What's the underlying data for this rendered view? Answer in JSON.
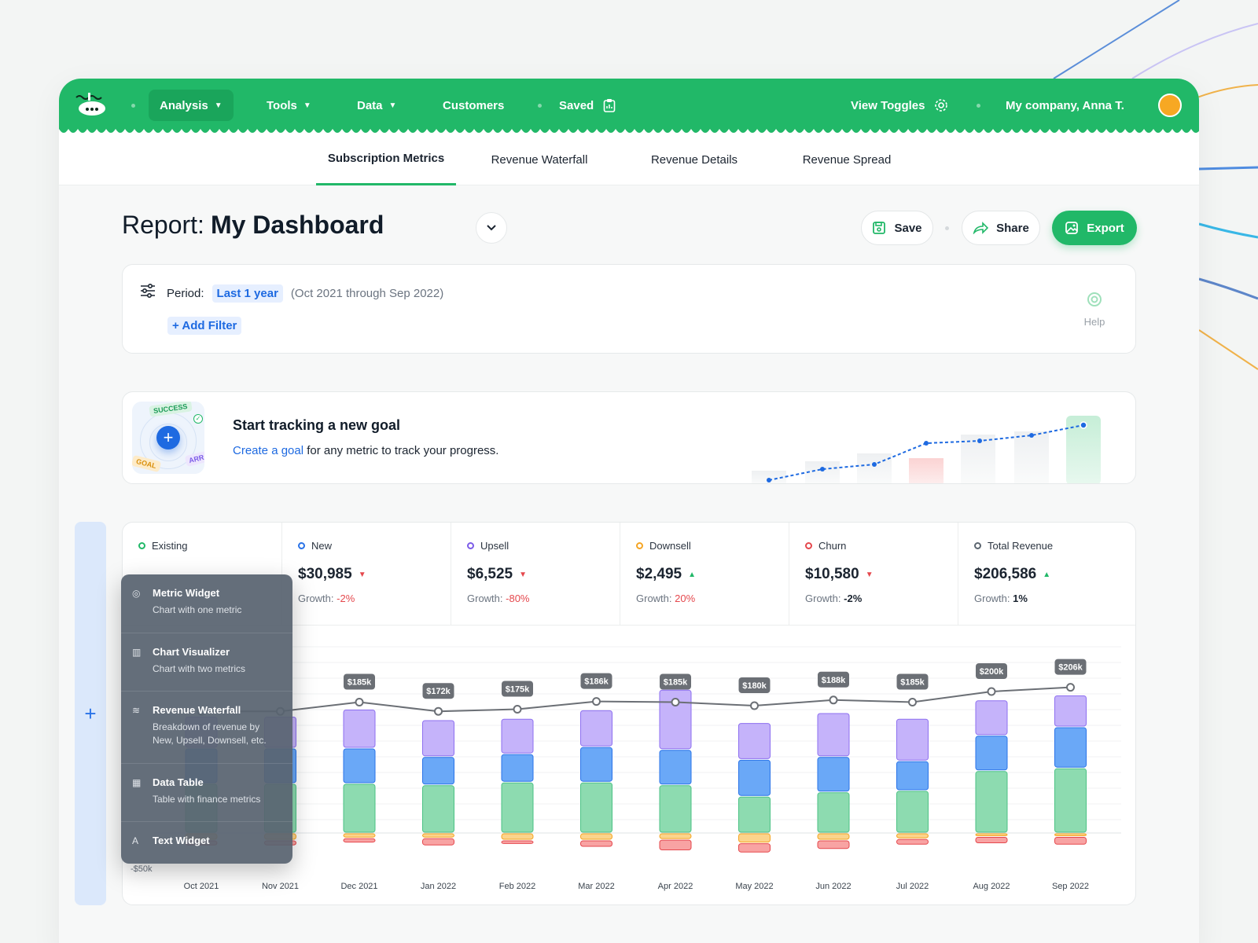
{
  "nav": {
    "items": [
      {
        "label": "Analysis",
        "has_caret": true,
        "active": true
      },
      {
        "label": "Tools",
        "has_caret": true
      },
      {
        "label": "Data",
        "has_caret": true
      },
      {
        "label": "Customers",
        "has_caret": false
      },
      {
        "label": "Saved",
        "has_caret": false
      }
    ],
    "view_toggles": "View Toggles",
    "account": "My company, Anna T."
  },
  "subnav": {
    "tabs": [
      "Subscription Metrics",
      "Revenue Waterfall",
      "Revenue Details",
      "Revenue Spread"
    ],
    "active_index": 0
  },
  "report": {
    "prefix": "Report:",
    "name": "My Dashboard",
    "save": "Save",
    "share": "Share",
    "export": "Export"
  },
  "filter": {
    "period_label": "Period:",
    "period_value": "Last 1 year",
    "period_range": "(Oct 2021 through Sep 2022)",
    "add_filter": "+ Add Filter",
    "help": "Help"
  },
  "goal": {
    "title": "Start tracking a new goal",
    "link": "Create a goal",
    "rest": " for any metric to track your progress.",
    "badge_success": "SUCCESS",
    "badge_goal": "GOAL",
    "badge_arr": "ARR"
  },
  "metrics": [
    {
      "label": "Existing",
      "color": "#21b868",
      "value": "",
      "growth_label": "",
      "growth": "",
      "trend": ""
    },
    {
      "label": "New",
      "color": "#2a73e8",
      "value": "$30,985",
      "growth_label": "Growth:",
      "growth": "-2%",
      "trend": "down"
    },
    {
      "label": "Upsell",
      "color": "#7c5ce8",
      "value": "$6,525",
      "growth_label": "Growth:",
      "growth": "-80%",
      "trend": "down"
    },
    {
      "label": "Downsell",
      "color": "#f5a524",
      "value": "$2,495",
      "growth_label": "Growth:",
      "growth": "20%",
      "trend": "up"
    },
    {
      "label": "Churn",
      "color": "#e5484d",
      "value": "$10,580",
      "growth_label": "Growth:",
      "growth": "-2%",
      "trend": "down"
    },
    {
      "label": "Total Revenue",
      "color": "#5c6670",
      "value": "$206,586",
      "growth_label": "Growth:",
      "growth": "1%",
      "trend": "up"
    }
  ],
  "popup": [
    {
      "title": "Metric Widget",
      "desc": "Chart with one metric",
      "icon": "target-icon"
    },
    {
      "title": "Chart Visualizer",
      "desc": "Chart with two metrics",
      "icon": "bar-chart-icon"
    },
    {
      "title": "Revenue Waterfall",
      "desc": "Breakdown of revenue by New, Upsell, Downsell, etc.",
      "icon": "wave-icon"
    },
    {
      "title": "Data Table",
      "desc": "Table with finance metrics",
      "icon": "table-icon"
    },
    {
      "title": "Text Widget",
      "desc": "",
      "icon": "text-icon"
    }
  ],
  "chart_data": {
    "type": "bar",
    "categories": [
      "Oct 2021",
      "Nov 2021",
      "Dec 2021",
      "Jan 2022",
      "Feb 2022",
      "Mar 2022",
      "Apr 2022",
      "May 2022",
      "Jun 2022",
      "Jul 2022",
      "Aug 2022",
      "Sep 2022"
    ],
    "y_tick_label": "-$50k",
    "series": [
      {
        "name": "Existing",
        "color": "#8ddbb0",
        "stroke": "#4cc285",
        "values": [
          70,
          70,
          70,
          68,
          72,
          72,
          68,
          52,
          58,
          60,
          88,
          92
        ]
      },
      {
        "name": "New",
        "color": "#6aa8f7",
        "stroke": "#2a73e8",
        "values": [
          50,
          50,
          50,
          40,
          40,
          50,
          50,
          52,
          50,
          42,
          50,
          58
        ]
      },
      {
        "name": "Upsell",
        "color": "#c5b3fa",
        "stroke": "#8d6ff0",
        "values": [
          45,
          45,
          55,
          52,
          50,
          52,
          85,
          52,
          62,
          60,
          50,
          45
        ]
      },
      {
        "name": "Downsell",
        "color": "#fcd48c",
        "stroke": "#f5a524",
        "values": [
          -10,
          -10,
          -7,
          -7,
          -10,
          -10,
          -9,
          -14,
          -10,
          -8,
          -5,
          -5
        ]
      },
      {
        "name": "Churn",
        "color": "#f8a3a3",
        "stroke": "#e5484d",
        "values": [
          -8,
          -8,
          -7,
          -11,
          -6,
          -10,
          -16,
          -14,
          -13,
          -9,
          -10,
          -12
        ]
      }
    ],
    "line": {
      "name": "Total Revenue",
      "values": [
        172,
        172,
        185,
        172,
        175,
        186,
        185,
        180,
        188,
        185,
        200,
        206
      ]
    },
    "data_labels": [
      "",
      "",
      "$185k",
      "$172k",
      "$175k",
      "$186k",
      "$185k",
      "$180k",
      "$188k",
      "$185k",
      "$200k",
      "$206k"
    ]
  }
}
